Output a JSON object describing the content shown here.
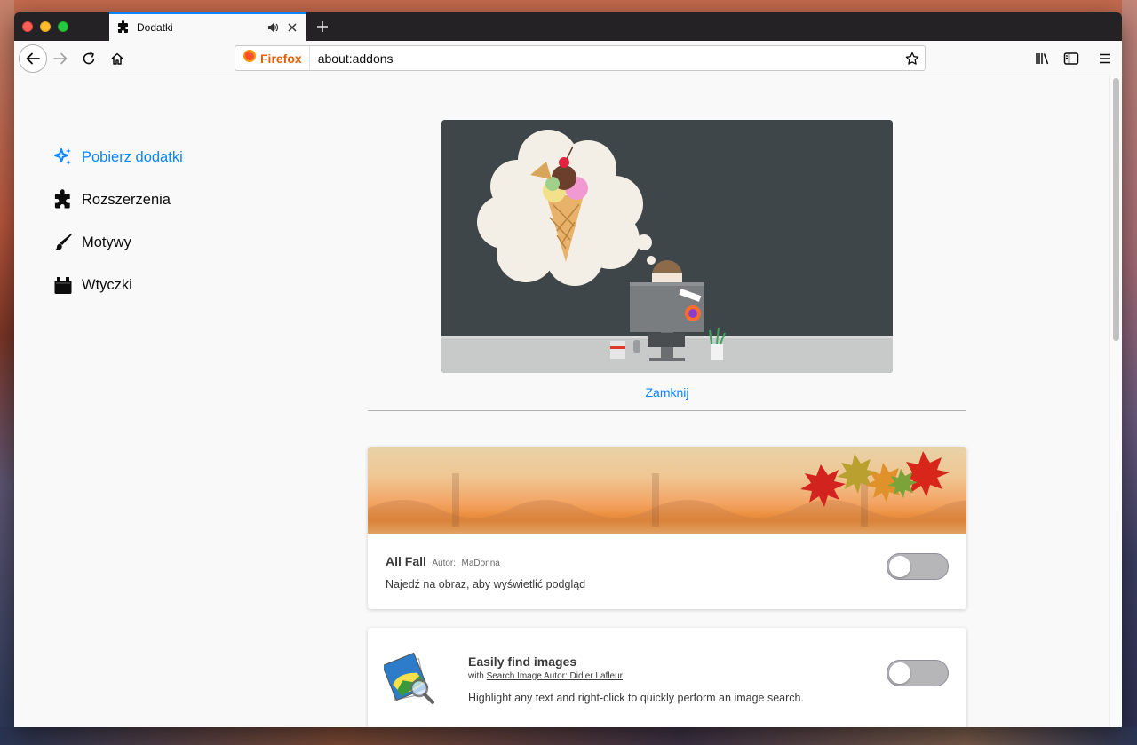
{
  "tab": {
    "title": "Dodatki",
    "icon": "puzzle-icon"
  },
  "urlbar": {
    "identity_label": "Firefox",
    "url": "about:addons"
  },
  "categories": [
    {
      "label": "Pobierz dodatki",
      "icon": "sparkle-icon",
      "selected": true
    },
    {
      "label": "Rozszerzenia",
      "icon": "puzzle-icon",
      "selected": false
    },
    {
      "label": "Motywy",
      "icon": "brush-icon",
      "selected": false
    },
    {
      "label": "Wtyczki",
      "icon": "plugin-icon",
      "selected": false
    }
  ],
  "hero": {
    "close_label": "Zamknij"
  },
  "addons": [
    {
      "name": "All Fall",
      "author_prefix": "Autor:",
      "author": "MaDonna",
      "description": "Najedź na obraz, aby wyświetlić podgląd",
      "enabled": false
    },
    {
      "name": "Easily find images",
      "with_prefix": "with",
      "with_link": "Search Image Autor: Didier Lafleur",
      "description": "Highlight any text and right-click to quickly perform an image search.",
      "enabled": false
    }
  ],
  "colors": {
    "accent": "#0a84ff",
    "firefox_orange": "#e66000"
  }
}
